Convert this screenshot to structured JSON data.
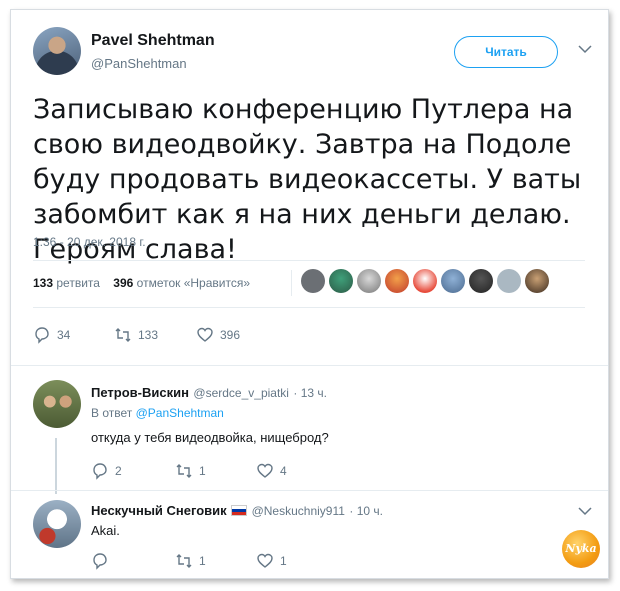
{
  "tweet": {
    "author_name": "Pavel Shehtman",
    "author_handle": "@PanShehtman",
    "follow_label": "Читать",
    "text": "Записываю конференцию Путлера на свою видеодвойку. Завтра на Подоле буду продовать видеокассеты. У ваты забомбит как я на них деньги делаю. Героям слава!",
    "timestamp": "1:36 - 20 дек. 2018 г.",
    "retweets_count": "133",
    "retweets_label": "ретвита",
    "likes_count": "396",
    "likes_label": "отметок «Нравится»",
    "actions": {
      "replies": "34",
      "retweets": "133",
      "likes": "396"
    }
  },
  "replies": [
    {
      "name": "Петров-Вискин",
      "handle": "@serdce_v_piatki",
      "time": "· 13 ч.",
      "reply_to_prefix": "В ответ",
      "reply_to": "@PanShehtman",
      "text": "откуда у тебя видеодвойка, нищеброд?",
      "actions": {
        "replies": "2",
        "retweets": "1",
        "likes": "4"
      }
    },
    {
      "name": "Нескучный Снеговик",
      "handle": "@Neskuchniy911",
      "time": "· 10 ч.",
      "text": "Akai.",
      "actions": {
        "replies": "",
        "retweets": "1",
        "likes": "1"
      }
    }
  ],
  "watermark": "Nyka",
  "colors": {
    "accent": "#1da1f2",
    "muted": "#657786",
    "text": "#14171a",
    "like": "#e0245e"
  }
}
